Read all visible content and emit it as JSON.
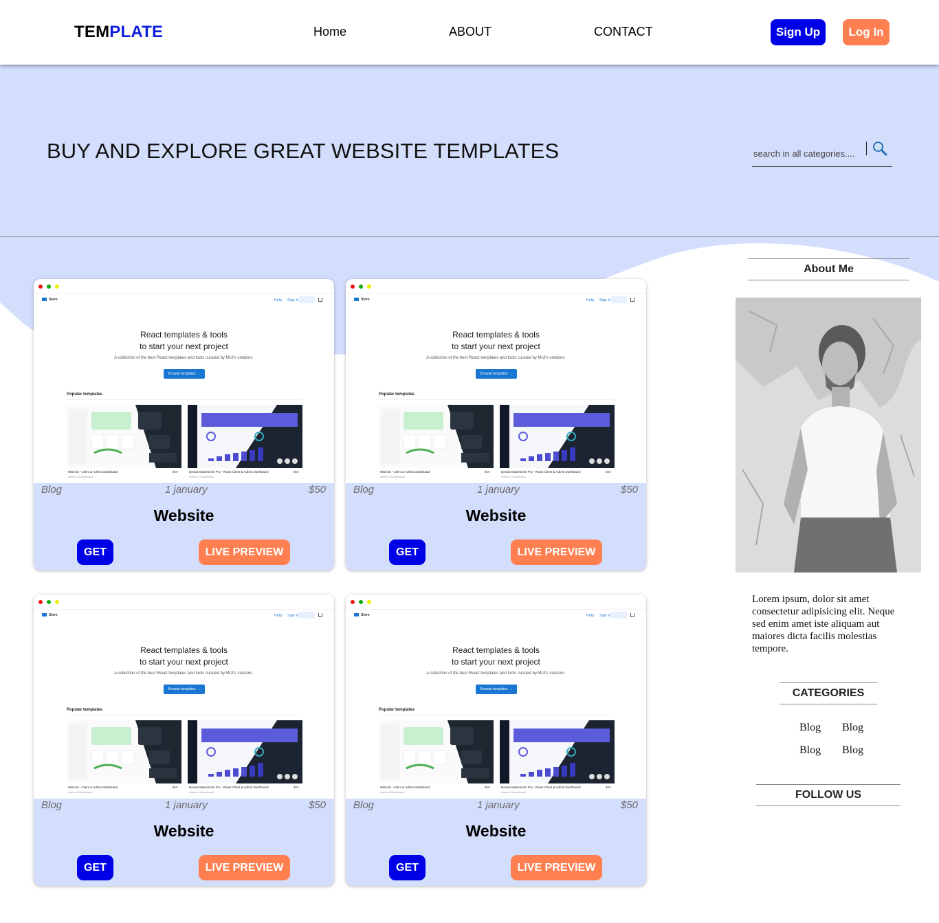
{
  "header": {
    "logo_part1": "TEM",
    "logo_part2": "PLATE",
    "nav": [
      "Home",
      "ABOUT",
      "CONTACT"
    ],
    "signup_label": "Sign Up",
    "login_label": "Log In"
  },
  "hero": {
    "title": "BUY AND EXPLORE GREAT WEBSITE TEMPLATES",
    "search_placeholder": "search in all categories...."
  },
  "preview": {
    "brand": "Store",
    "nav": [
      "Help",
      "Sign In",
      "Sign Up"
    ],
    "headline_line1": "React templates & tools",
    "headline_line2": "to start your next project",
    "subtitle": "A collection of the best React templates and tools curated by MUI's creators.",
    "browse_label": "Browse templates →",
    "popular_label": "Popular templates",
    "items": [
      {
        "title": "Minimal - Client & Admin Dashboard",
        "price": "$69",
        "category": "Admin & Dashboard"
      },
      {
        "title": "Devias Material Kit Pro - React Client & Admin Dashboard",
        "price": "$69",
        "category": "Admin & Dashboard"
      }
    ]
  },
  "cards": [
    {
      "category": "Blog",
      "date": "1 january",
      "price": "$50",
      "title": "Website",
      "get_label": "GET",
      "preview_label": "LIVE PREVIEW"
    },
    {
      "category": "Blog",
      "date": "1 january",
      "price": "$50",
      "title": "Website",
      "get_label": "GET",
      "preview_label": "LIVE PREVIEW"
    },
    {
      "category": "Blog",
      "date": "1 january",
      "price": "$50",
      "title": "Website",
      "get_label": "GET",
      "preview_label": "LIVE PREVIEW"
    },
    {
      "category": "Blog",
      "date": "1 january",
      "price": "$50",
      "title": "Website",
      "get_label": "GET",
      "preview_label": "LIVE PREVIEW"
    }
  ],
  "sidebar": {
    "about_heading": "About Me",
    "about_text": "Lorem ipsum, dolor sit amet consectetur adipisicing elit. Neque sed enim amet iste aliquam aut maiores dicta facilis molestias tempore.",
    "categories_heading": "CATEGORIES",
    "categories": [
      "Blog",
      "Blog",
      "Blog",
      "Blog"
    ],
    "follow_heading": "FOLLOW US"
  },
  "colors": {
    "primary_blue": "#0000e6",
    "accent_orange": "#ff7f50",
    "hero_bg": "#d3ddfc",
    "logo_blue": "#0d1ddb"
  },
  "icons": {
    "search": "magnifier-icon"
  }
}
